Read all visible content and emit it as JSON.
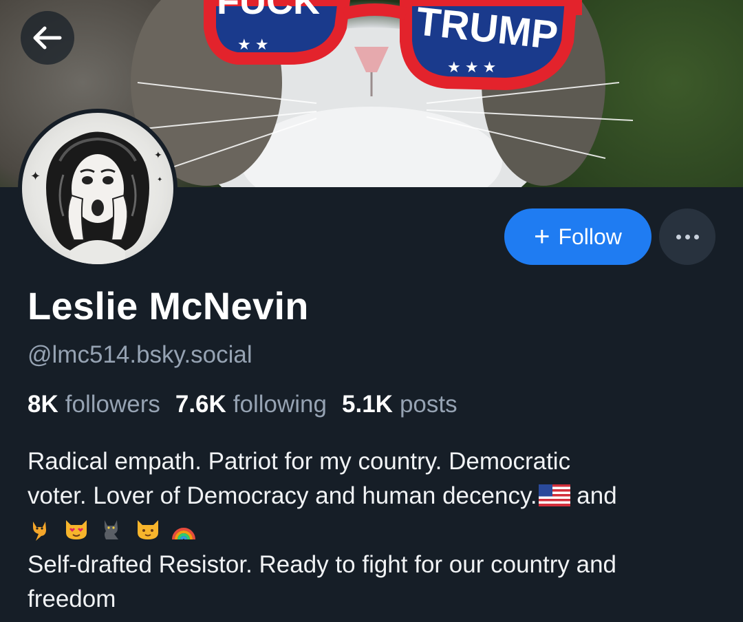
{
  "header": {
    "banner_text_left": "FUCK",
    "banner_text_right": "TRUMP"
  },
  "profile": {
    "display_name": "Leslie McNevin",
    "handle": "@lmc514.bsky.social",
    "followers_count": "8K",
    "followers_label": "followers",
    "following_count": "7.6K",
    "following_label": "following",
    "posts_count": "5.1K",
    "posts_label": "posts"
  },
  "actions": {
    "follow_label": "Follow",
    "follow_icon": "plus-icon",
    "more_icon": "more-options-icon",
    "back_icon": "back-arrow-icon"
  },
  "bio": {
    "line1": "Radical empath. Patriot for my country.  Democratic",
    "line2": "voter. Lover of Democracy and human decency.",
    "line2_end": " and",
    "emoji_names": [
      "cat-icon",
      "heart-eyes-cat-icon",
      "black-cat-icon",
      "cat-face-icon",
      "rainbow-icon",
      "us-flag-icon"
    ],
    "line4": "Self-drafted Resistor. Ready to fight for our country and",
    "line5": "freedom"
  },
  "colors": {
    "background": "#161e27",
    "accent": "#1f7cf2",
    "muted_text": "#96a3b3",
    "primary_text": "#ffffff"
  }
}
